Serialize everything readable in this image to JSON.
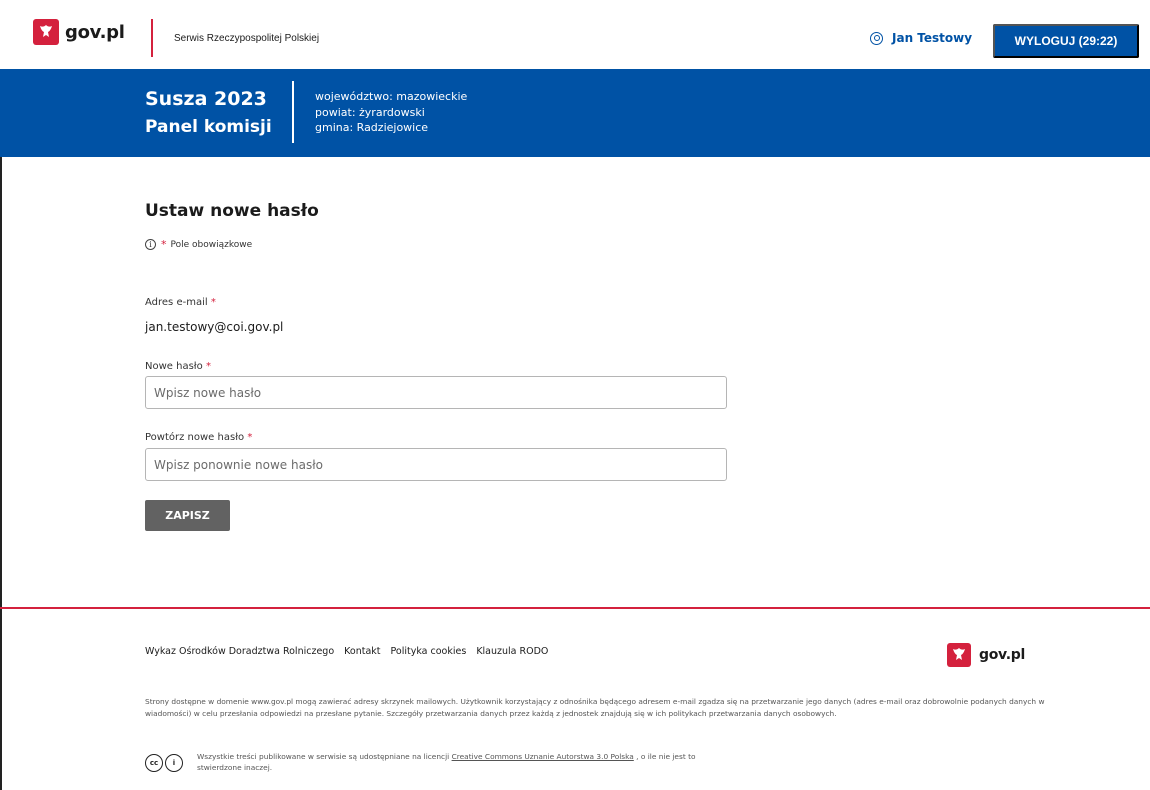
{
  "header": {
    "logo_text": "gov.pl",
    "service_name": "Serwis Rzeczypospolitej Polskiej",
    "user_name": "Jan Testowy",
    "logout_label": "WYLOGUJ (29:22)"
  },
  "banner": {
    "title_line1": "Susza 2023",
    "title_line2": "Panel komisji",
    "voivodeship": "województwo: mazowieckie",
    "county": "powiat: żyrardowski",
    "commune": "gmina: Radziejowice"
  },
  "form": {
    "title": "Ustaw nowe hasło",
    "required_note_star": "*",
    "required_note": "Pole obowiązkowe",
    "email_label": "Adres e-mail",
    "email_value": "jan.testowy@coi.gov.pl",
    "new_password_label": "Nowe hasło",
    "new_password_placeholder": "Wpisz nowe hasło",
    "repeat_password_label": "Powtórz nowe hasło",
    "repeat_password_placeholder": "Wpisz ponownie nowe hasło",
    "required_marker": "*",
    "save_label": "ZAPISZ"
  },
  "footer": {
    "links": [
      "Wykaz Ośrodków Doradztwa Rolniczego",
      "Kontakt",
      "Polityka cookies",
      "Klauzula RODO"
    ],
    "logo_text": "gov.pl",
    "legal_text": "Strony dostępne w domenie www.gov.pl mogą zawierać adresy skrzynek mailowych. Użytkownik korzystający z odnośnika będącego adresem e-mail zgadza się na przetwarzanie jego danych (adres e-mail oraz dobrowolnie podanych danych w wiadomości) w celu przesłania odpowiedzi na przesłane pytanie. Szczegóły przetwarzania danych przez każdą z jednostek znajdują się w ich politykach przetwarzania danych osobowych.",
    "license_prefix": "Wszystkie treści publikowane w serwisie są udostępniane na licencji",
    "license_link": "Creative Commons Uznanie Autorstwa 3.0 Polska",
    "license_suffix": ", o ile nie jest to stwierdzone inaczej.",
    "cc_icon_label": "cc",
    "by_icon_label": "i"
  },
  "colors": {
    "brand_blue": "#0052a5",
    "brand_red": "#d4213d",
    "button_gray": "#626262"
  }
}
